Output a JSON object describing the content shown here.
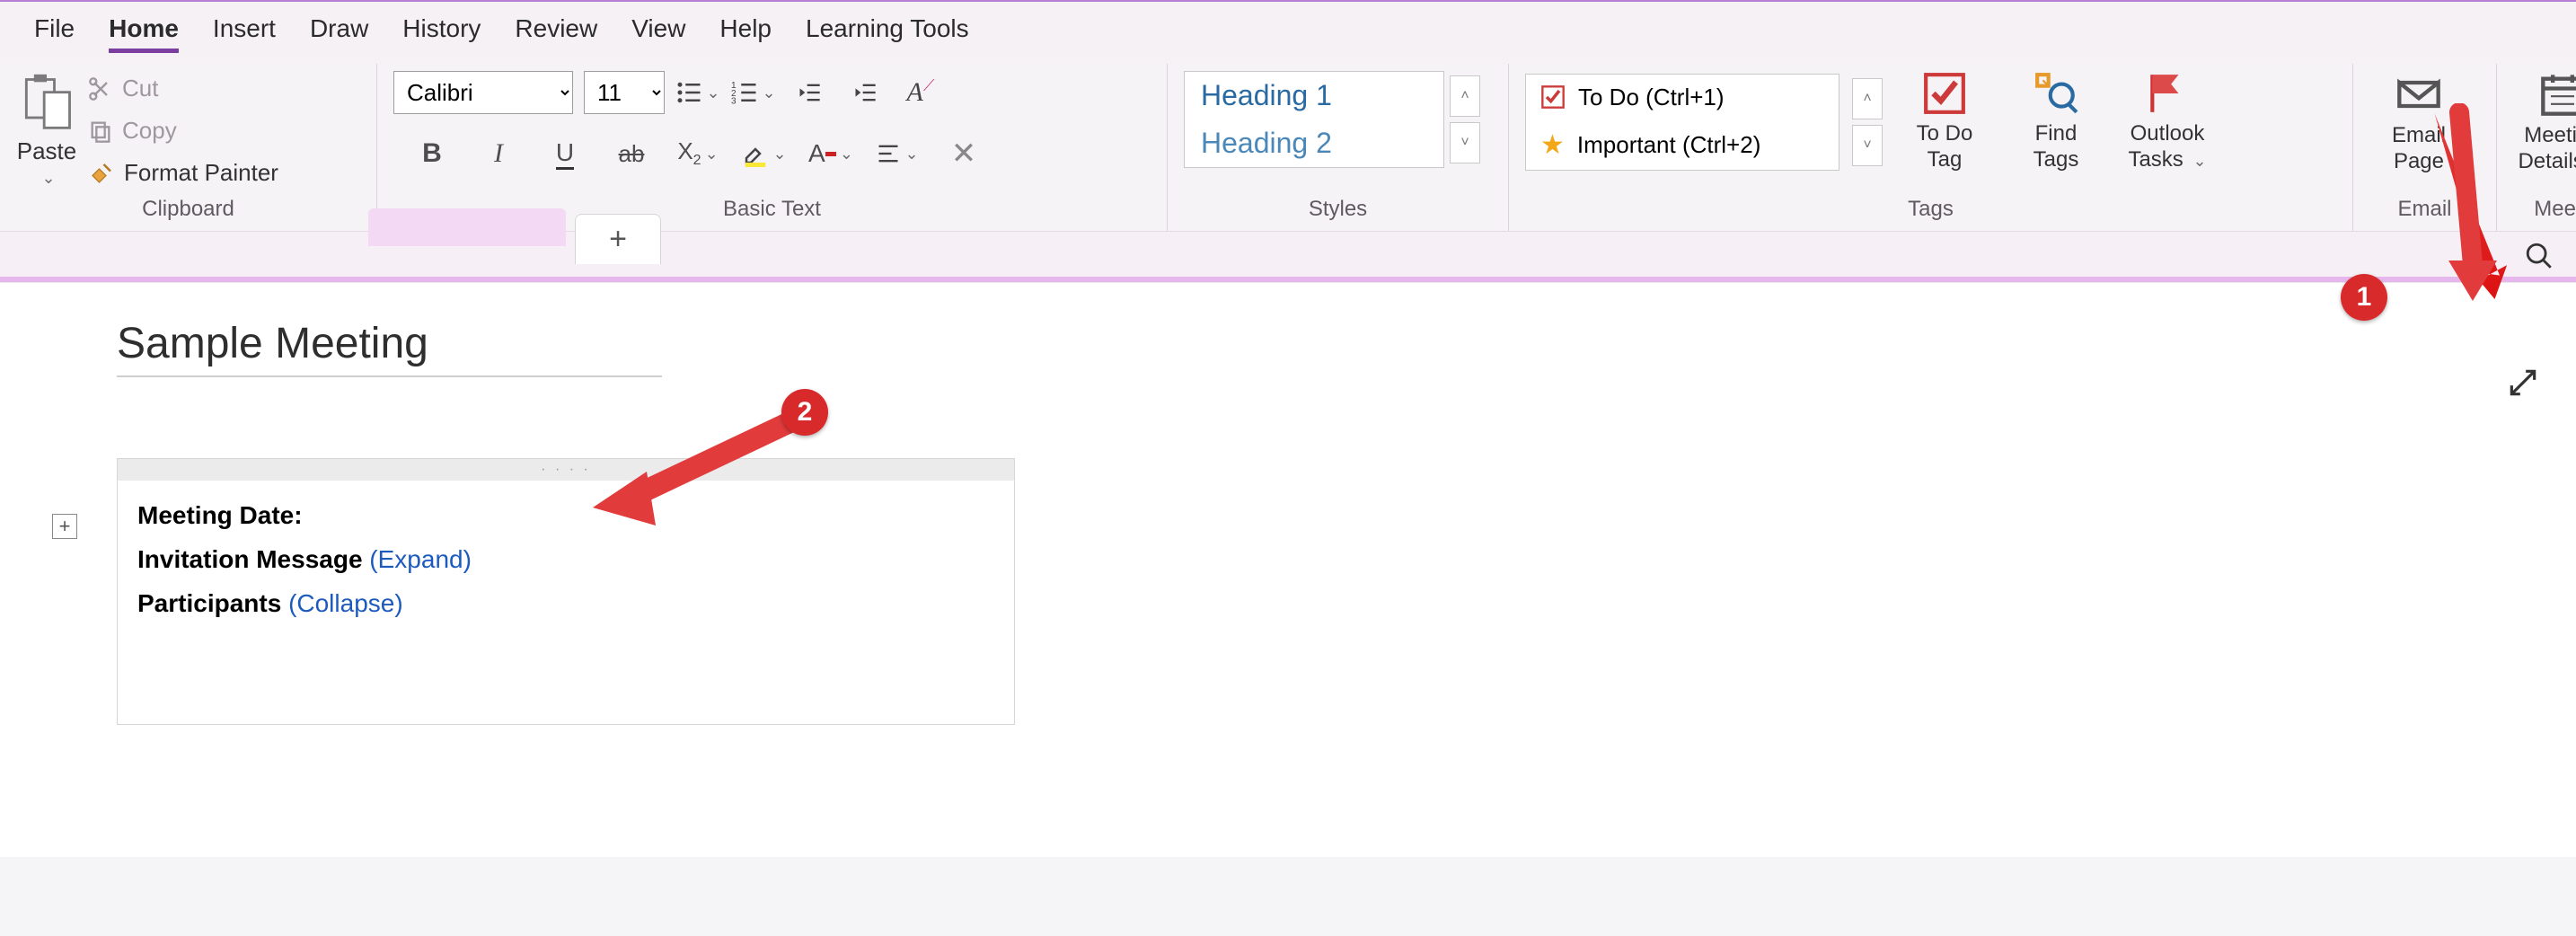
{
  "menu": {
    "file": "File",
    "home": "Home",
    "insert": "Insert",
    "draw": "Draw",
    "history": "History",
    "review": "Review",
    "view": "View",
    "help": "Help",
    "learning_tools": "Learning Tools"
  },
  "ribbon": {
    "clipboard": {
      "paste": "Paste",
      "cut": "Cut",
      "copy": "Copy",
      "format_painter": "Format Painter",
      "group_label": "Clipboard"
    },
    "basic_text": {
      "font_name": "Calibri",
      "font_size": "11",
      "group_label": "Basic Text"
    },
    "styles": {
      "heading1": "Heading 1",
      "heading2": "Heading 2",
      "group_label": "Styles"
    },
    "tags": {
      "todo": "To Do (Ctrl+1)",
      "important": "Important (Ctrl+2)",
      "todo_tag": "To Do\nTag",
      "find_tags": "Find\nTags",
      "outlook_tasks": "Outlook\nTasks",
      "group_label": "Tags"
    },
    "email": {
      "email_page": "Email\nPage",
      "group_label": "Email"
    },
    "meetings": {
      "meeting_details": "Meeting\nDetails",
      "group_label": "Meetings"
    }
  },
  "page": {
    "title": "Sample Meeting",
    "meeting_date_label": "Meeting Date:",
    "meeting_date_value": "",
    "invitation_label": "Invitation Message ",
    "invitation_action": "(Expand)",
    "participants_label": "Participants ",
    "participants_action": "(Collapse)"
  },
  "annotations": {
    "badge1": "1",
    "badge2": "2"
  },
  "icons": {
    "add": "+",
    "chevron": "⌄"
  }
}
